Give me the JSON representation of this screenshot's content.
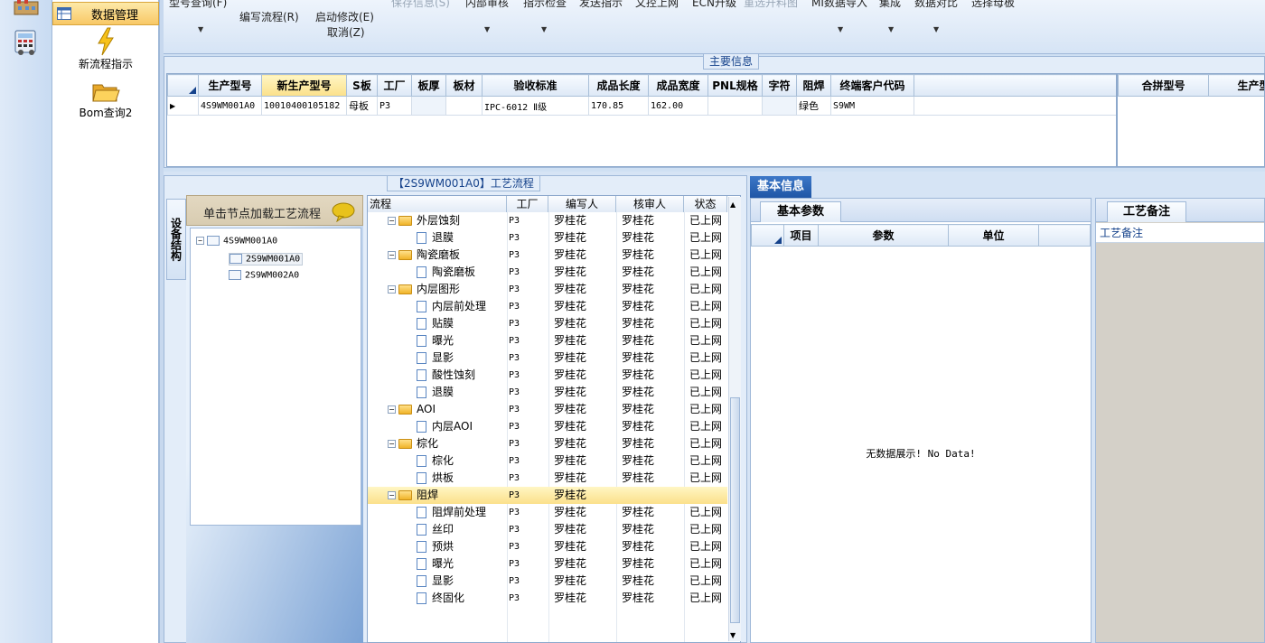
{
  "nav": {
    "data_management": "数据管理",
    "new_flow_instruction": "新流程指示",
    "bom_query2": "Bom查询2"
  },
  "toolbar": {
    "model_query": "型号查询(F)",
    "write_flow": "编写流程(R)",
    "start_modify": "启动修改(E)",
    "cancel": "取消(Z)",
    "save_info": "保存信息(S)",
    "internal_review": "内部审核",
    "instruction_check": "指示检查",
    "send_instruction": "发送指示",
    "doc_upload": "文控上网",
    "ecn_upgrade": "ECN升级",
    "reselect_material": "重选开料图",
    "mi_import": "MI数据导入",
    "integration": "集成",
    "data_compare": "数据对比",
    "select_parent": "选择母板"
  },
  "main_info": {
    "title": "主要信息",
    "columns": [
      "生产型号",
      "新生产型号",
      "S板",
      "工厂",
      "板厚",
      "板材",
      "验收标准",
      "成品长度",
      "成品宽度",
      "PNL规格",
      "字符",
      "阻焊",
      "终端客户代码"
    ],
    "row": [
      "4S9WM001A0",
      "10010400105182",
      "母板",
      "P3",
      "",
      "",
      "IPC-6012 Ⅱ级",
      "170.85",
      "162.00",
      "",
      "",
      "绿色",
      "S9WM"
    ],
    "side_columns": [
      "合拼型号",
      "生产型"
    ]
  },
  "process": {
    "title": "【2S9WM001A0】工艺流程",
    "sidebar_tab": "设备结构",
    "tree_header": "单击节点加载工艺流程",
    "tree_nodes": [
      "4S9WM001A0",
      "2S9WM001A0",
      "2S9WM002A0"
    ],
    "columns": [
      "流程",
      "工厂",
      "编写人",
      "核审人",
      "状态"
    ],
    "rows": [
      {
        "name": "外层蚀刻",
        "folder": true,
        "factory": "P3",
        "writer": "罗桂花",
        "reviewer": "罗桂花",
        "status": "已上网"
      },
      {
        "name": "退膜",
        "folder": false,
        "factory": "P3",
        "writer": "罗桂花",
        "reviewer": "罗桂花",
        "status": "已上网"
      },
      {
        "name": "陶瓷磨板",
        "folder": true,
        "factory": "P3",
        "writer": "罗桂花",
        "reviewer": "罗桂花",
        "status": "已上网"
      },
      {
        "name": "陶瓷磨板",
        "folder": false,
        "factory": "P3",
        "writer": "罗桂花",
        "reviewer": "罗桂花",
        "status": "已上网"
      },
      {
        "name": "内层图形",
        "folder": true,
        "factory": "P3",
        "writer": "罗桂花",
        "reviewer": "罗桂花",
        "status": "已上网"
      },
      {
        "name": "内层前处理",
        "folder": false,
        "factory": "P3",
        "writer": "罗桂花",
        "reviewer": "罗桂花",
        "status": "已上网"
      },
      {
        "name": "贴膜",
        "folder": false,
        "factory": "P3",
        "writer": "罗桂花",
        "reviewer": "罗桂花",
        "status": "已上网"
      },
      {
        "name": "曝光",
        "folder": false,
        "factory": "P3",
        "writer": "罗桂花",
        "reviewer": "罗桂花",
        "status": "已上网"
      },
      {
        "name": "显影",
        "folder": false,
        "factory": "P3",
        "writer": "罗桂花",
        "reviewer": "罗桂花",
        "status": "已上网"
      },
      {
        "name": "酸性蚀刻",
        "folder": false,
        "factory": "P3",
        "writer": "罗桂花",
        "reviewer": "罗桂花",
        "status": "已上网"
      },
      {
        "name": "退膜",
        "folder": false,
        "factory": "P3",
        "writer": "罗桂花",
        "reviewer": "罗桂花",
        "status": "已上网"
      },
      {
        "name": "AOI",
        "folder": true,
        "factory": "P3",
        "writer": "罗桂花",
        "reviewer": "罗桂花",
        "status": "已上网"
      },
      {
        "name": "内层AOI",
        "folder": false,
        "factory": "P3",
        "writer": "罗桂花",
        "reviewer": "罗桂花",
        "status": "已上网"
      },
      {
        "name": "棕化",
        "folder": true,
        "factory": "P3",
        "writer": "罗桂花",
        "reviewer": "罗桂花",
        "status": "已上网"
      },
      {
        "name": "棕化",
        "folder": false,
        "factory": "P3",
        "writer": "罗桂花",
        "reviewer": "罗桂花",
        "status": "已上网"
      },
      {
        "name": "烘板",
        "folder": false,
        "factory": "P3",
        "writer": "罗桂花",
        "reviewer": "罗桂花",
        "status": "已上网"
      },
      {
        "name": "阻焊",
        "folder": true,
        "factory": "P3",
        "writer": "罗桂花",
        "reviewer": "",
        "status": "",
        "selected": true
      },
      {
        "name": "阻焊前处理",
        "folder": false,
        "factory": "P3",
        "writer": "罗桂花",
        "reviewer": "罗桂花",
        "status": "已上网"
      },
      {
        "name": "丝印",
        "folder": false,
        "factory": "P3",
        "writer": "罗桂花",
        "reviewer": "罗桂花",
        "status": "已上网"
      },
      {
        "name": "预烘",
        "folder": false,
        "factory": "P3",
        "writer": "罗桂花",
        "reviewer": "罗桂花",
        "status": "已上网"
      },
      {
        "name": "曝光",
        "folder": false,
        "factory": "P3",
        "writer": "罗桂花",
        "reviewer": "罗桂花",
        "status": "已上网"
      },
      {
        "name": "显影",
        "folder": false,
        "factory": "P3",
        "writer": "罗桂花",
        "reviewer": "罗桂花",
        "status": "已上网"
      },
      {
        "name": "终固化",
        "folder": false,
        "factory": "P3",
        "writer": "罗桂花",
        "reviewer": "罗桂花",
        "status": "已上网"
      }
    ]
  },
  "basic_info": {
    "tab": "基本信息",
    "params_tab": "基本参数",
    "columns": [
      "项目",
      "参数",
      "单位"
    ],
    "empty_text": "无数据展示! No Data!"
  },
  "notes": {
    "tab": "工艺备注",
    "label": "工艺备注"
  }
}
